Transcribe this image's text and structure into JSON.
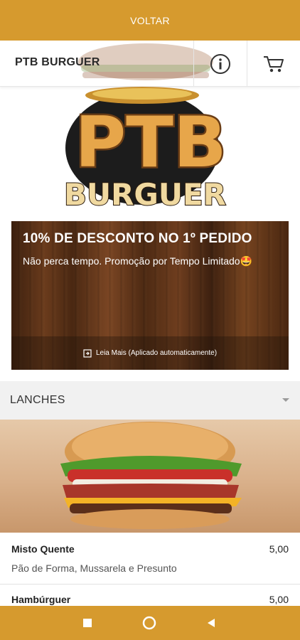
{
  "topbar": {
    "back_label": "VOLTAR"
  },
  "header": {
    "title": "PTB BURGUER",
    "info_icon": "info-icon",
    "cart_icon": "cart-icon"
  },
  "logo": {
    "top_text": "PTB",
    "bottom_text": "BURGUER"
  },
  "promo": {
    "title": "10% DE DESCONTO NO 1º PEDIDO",
    "text": "Não perca tempo. Promoção por Tempo Limitado🤩",
    "read_more": "Leia Mais (Aplicado automaticamente)"
  },
  "section": {
    "title": "LANCHES"
  },
  "items": [
    {
      "name": "Misto Quente",
      "price": "5,00",
      "description": "Pão de Forma, Mussarela e Presunto"
    },
    {
      "name": "Hambúrguer",
      "price": "5,00"
    }
  ],
  "colors": {
    "accent": "#d69a2e",
    "header_bg": "#ffffff",
    "section_bg": "#f1f1f1"
  }
}
